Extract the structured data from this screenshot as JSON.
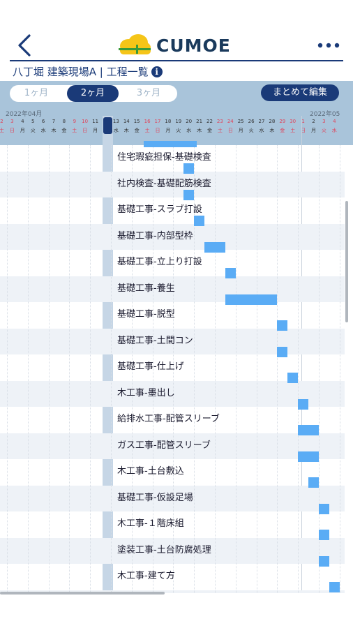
{
  "app": {
    "logo_text": "CUMOE"
  },
  "header": {
    "subtitle": "八丁堀 建築現場A | 工程一覧",
    "info_icon": "i"
  },
  "controls": {
    "tabs": [
      {
        "label": "1ヶ月"
      },
      {
        "label": "2ヶ月"
      },
      {
        "label": "3ヶ月"
      }
    ],
    "active_tab": "2ヶ月",
    "bulk_edit_label": "まとめて編集"
  },
  "calendar": {
    "month_left": "2022年04月",
    "month_right": "2022年05",
    "days": [
      {
        "d": "2",
        "w": "土",
        "c": "red"
      },
      {
        "d": "3",
        "w": "日",
        "c": "red"
      },
      {
        "d": "4",
        "w": "月",
        "c": ""
      },
      {
        "d": "5",
        "w": "火",
        "c": ""
      },
      {
        "d": "6",
        "w": "水",
        "c": ""
      },
      {
        "d": "7",
        "w": "木",
        "c": ""
      },
      {
        "d": "8",
        "w": "金",
        "c": ""
      },
      {
        "d": "9",
        "w": "土",
        "c": "red"
      },
      {
        "d": "10",
        "w": "日",
        "c": "red"
      },
      {
        "d": "11",
        "w": "月",
        "c": ""
      },
      {
        "d": "12",
        "w": "",
        "c": "today"
      },
      {
        "d": "13",
        "w": "水",
        "c": ""
      },
      {
        "d": "14",
        "w": "木",
        "c": ""
      },
      {
        "d": "15",
        "w": "金",
        "c": ""
      },
      {
        "d": "16",
        "w": "土",
        "c": "red"
      },
      {
        "d": "17",
        "w": "日",
        "c": "red"
      },
      {
        "d": "18",
        "w": "月",
        "c": ""
      },
      {
        "d": "19",
        "w": "火",
        "c": ""
      },
      {
        "d": "20",
        "w": "水",
        "c": ""
      },
      {
        "d": "21",
        "w": "木",
        "c": ""
      },
      {
        "d": "22",
        "w": "金",
        "c": ""
      },
      {
        "d": "23",
        "w": "土",
        "c": "red"
      },
      {
        "d": "24",
        "w": "日",
        "c": "red"
      },
      {
        "d": "25",
        "w": "月",
        "c": ""
      },
      {
        "d": "26",
        "w": "火",
        "c": ""
      },
      {
        "d": "27",
        "w": "水",
        "c": ""
      },
      {
        "d": "28",
        "w": "木",
        "c": ""
      },
      {
        "d": "29",
        "w": "金",
        "c": "red"
      },
      {
        "d": "30",
        "w": "土",
        "c": "red"
      },
      {
        "d": "1",
        "w": "日",
        "c": "red"
      },
      {
        "d": "2",
        "w": "月",
        "c": ""
      },
      {
        "d": "3",
        "w": "火",
        "c": "red"
      },
      {
        "d": "4",
        "w": "水",
        "c": "red"
      }
    ]
  },
  "tasks": [
    {
      "label": "住宅瑕疵担保-基礎検査",
      "start": 20,
      "span": 1
    },
    {
      "label": "社内検査-基礎配筋検査",
      "start": 20,
      "span": 1
    },
    {
      "label": "基礎工事-スラブ打設",
      "start": 21,
      "span": 1
    },
    {
      "label": "基礎工事-内部型枠",
      "start": 22,
      "span": 2
    },
    {
      "label": "基礎工事-立上り打設",
      "start": 24,
      "span": 1
    },
    {
      "label": "基礎工事-養生",
      "start": 24,
      "span": 5
    },
    {
      "label": "基礎工事-脱型",
      "start": 29,
      "span": 1
    },
    {
      "label": "基礎工事-土間コン",
      "start": 29,
      "span": 1
    },
    {
      "label": "基礎工事-仕上げ",
      "start": 30,
      "span": 1
    },
    {
      "label": "木工事-墨出し",
      "start": 31,
      "span": 1
    },
    {
      "label": "給排水工事-配管スリーブ",
      "start": 31,
      "span": 2
    },
    {
      "label": "ガス工事-配管スリーブ",
      "start": 31,
      "span": 2
    },
    {
      "label": "木工事-土台敷込",
      "start": 32,
      "span": 1
    },
    {
      "label": "基礎工事-仮設足場",
      "start": 33,
      "span": 1
    },
    {
      "label": "木工事-１階床組",
      "start": 33,
      "span": 1
    },
    {
      "label": "塗装工事-土台防腐処理",
      "start": 33,
      "span": 1
    },
    {
      "label": "木工事-建て方",
      "start": 34,
      "span": 1
    }
  ],
  "colors": {
    "accent": "#1a3a78",
    "bar": "#5aacf5",
    "weekend": "#e0445a",
    "band": "#a9c4da"
  }
}
